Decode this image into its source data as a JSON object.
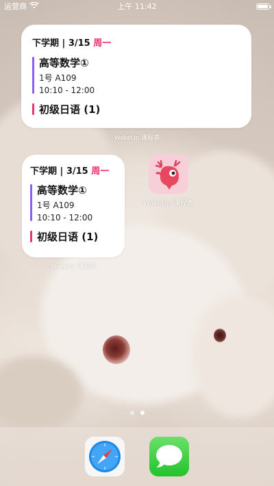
{
  "status_bar": {
    "carrier": "运营商",
    "time": "上午 11:42",
    "battery_level": 0.95
  },
  "widget_large": {
    "term": "下学期",
    "date": "3/15",
    "weekday": "周一",
    "course1": {
      "name": "高等数学①",
      "room": "1号 A109",
      "time": "10:10 - 12:00",
      "color": "#8b5cf6"
    },
    "course2": {
      "name": "初级日语 (1)",
      "color": "#e8336b"
    },
    "label": "WakeUp 课程表"
  },
  "widget_small": {
    "term": "下学期",
    "date": "3/15",
    "weekday": "周一",
    "course1": {
      "name": "高等数学①",
      "room": "1号 A109",
      "time": "10:10 - 12:00",
      "color": "#8b5cf6"
    },
    "course2": {
      "name": "初级日语 (1)",
      "color": "#e8336b"
    },
    "label": "WakeUp 课程表"
  },
  "app": {
    "label": "WakeUp 课程表",
    "icon": "wakeup-deer-icon"
  },
  "page_dots": {
    "count": 2,
    "active": 1
  },
  "dock": {
    "apps": [
      {
        "name": "Safari",
        "icon": "safari-icon"
      },
      {
        "name": "Messages",
        "icon": "messages-icon"
      }
    ]
  }
}
